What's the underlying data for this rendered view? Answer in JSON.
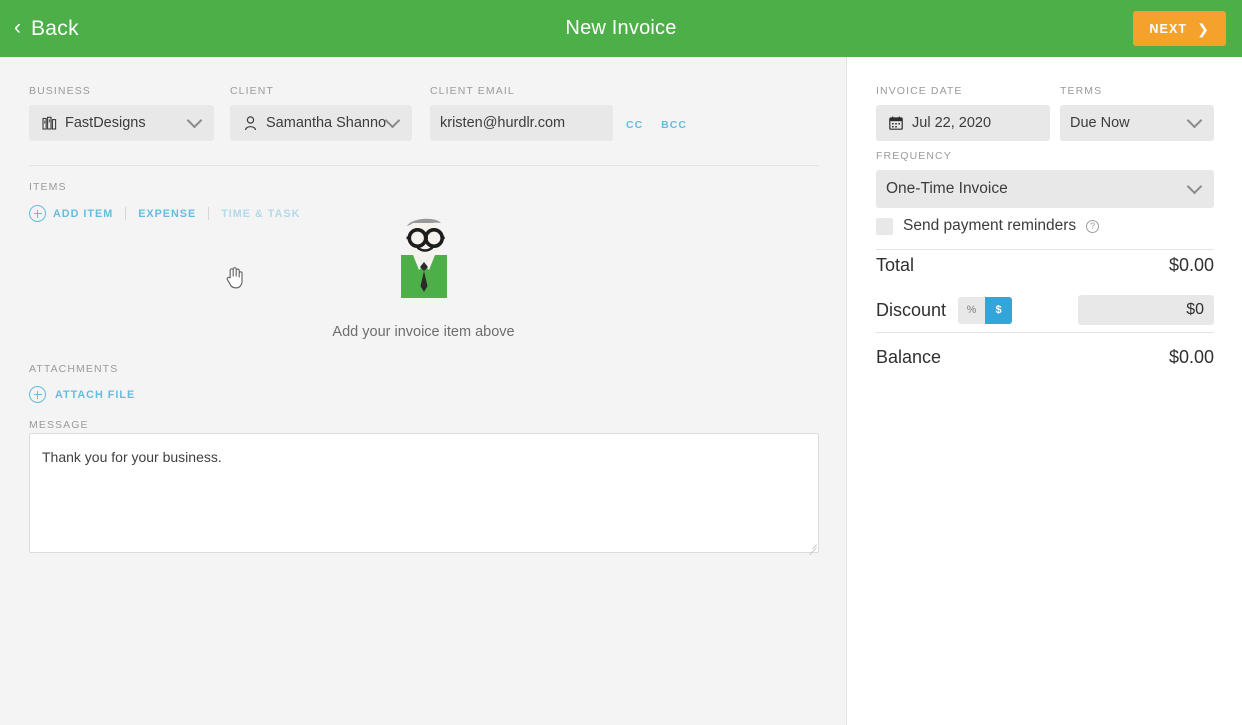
{
  "header": {
    "back_label": "Back",
    "title": "New Invoice",
    "next_label": "NEXT",
    "bg_color": "#4caf47",
    "next_color": "#f5a22d"
  },
  "left": {
    "business": {
      "label": "BUSINESS",
      "value": "FastDesigns",
      "icon": "building-icon"
    },
    "client": {
      "label": "CLIENT",
      "value": "Samantha Shannon",
      "icon": "person-icon"
    },
    "client_email": {
      "label": "CLIENT EMAIL",
      "value": "kristen@hurdlr.com",
      "cc_label": "CC",
      "bcc_label": "BCC"
    },
    "items": {
      "label": "ITEMS",
      "add_item_label": "ADD ITEM",
      "expense_label": "EXPENSE",
      "time_task_label": "TIME & TASK",
      "empty_text": "Add your invoice item above"
    },
    "attachments": {
      "label": "ATTACHMENTS",
      "attach_file_label": "ATTACH FILE"
    },
    "message": {
      "label": "MESSAGE",
      "value": "Thank you for your business."
    }
  },
  "right": {
    "invoice_date": {
      "label": "INVOICE DATE",
      "value": "Jul 22, 2020",
      "icon": "calendar-icon"
    },
    "terms": {
      "label": "TERMS",
      "value": "Due Now"
    },
    "frequency": {
      "label": "FREQUENCY",
      "value": "One-Time Invoice"
    },
    "reminders": {
      "label": "Send payment reminders",
      "checked": false,
      "help_glyph": "?"
    },
    "totals": {
      "total_label": "Total",
      "total_value": "$0.00",
      "discount_label": "Discount",
      "discount_percent_btn": "%",
      "discount_dollar_btn": "$",
      "discount_active": "$",
      "discount_value": "$0",
      "balance_label": "Balance",
      "balance_value": "$0.00",
      "active_toggle_color": "#34a5d8"
    }
  }
}
